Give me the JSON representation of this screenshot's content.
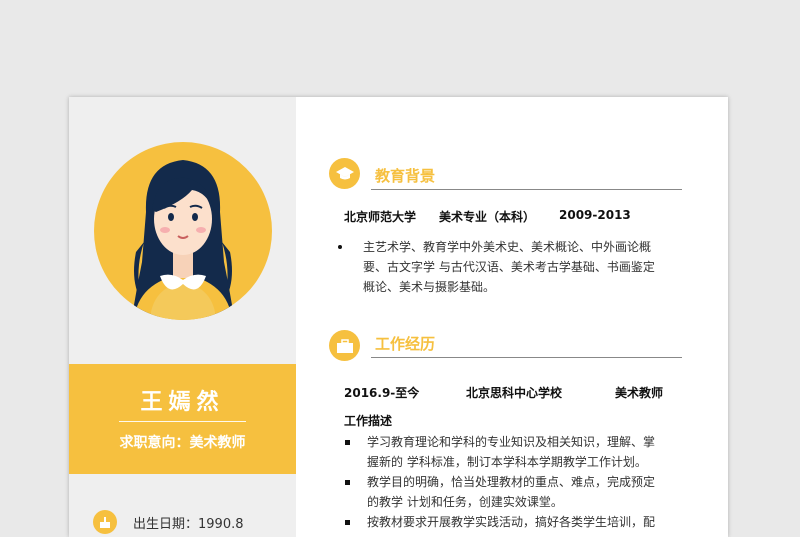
{
  "profile": {
    "name": "王嫣然",
    "objective": "求职意向：美术教师",
    "birth": "出生日期：1990.8"
  },
  "education": {
    "title": "教育背景",
    "school": "北京师范大学",
    "major": "美术专业（本科）",
    "period": "2009-2013",
    "details": [
      "主艺术学、教育学中外美术史、美术概论、中外画论概",
      "要、古文字学 与古代汉语、美术考古学基础、书画鉴定",
      "概论、美术与摄影基础。"
    ]
  },
  "work": {
    "title": "工作经历",
    "period": "2016.9-至今",
    "company": "北京思科中心学校",
    "position": "美术教师",
    "desc_title": "工作描述",
    "items": [
      {
        "lines": [
          "学习教育理论和学科的专业知识及相关知识，理解、掌",
          "握新的 学科标准，制订本学科本学期教学工作计划。"
        ]
      },
      {
        "lines": [
          "教学目的明确，恰当处理教材的重点、难点，完成预定",
          "的教学 计划和任务，创建实效课堂。"
        ]
      },
      {
        "lines": [
          "按教材要求开展教学实践活动，搞好各类学生培训，配"
        ]
      }
    ]
  },
  "icons": {
    "education": "graduation-cap-icon",
    "work": "briefcase-icon",
    "birth": "cake-icon"
  },
  "colors": {
    "accent": "#f6c03f",
    "sidebar": "#efefef"
  }
}
